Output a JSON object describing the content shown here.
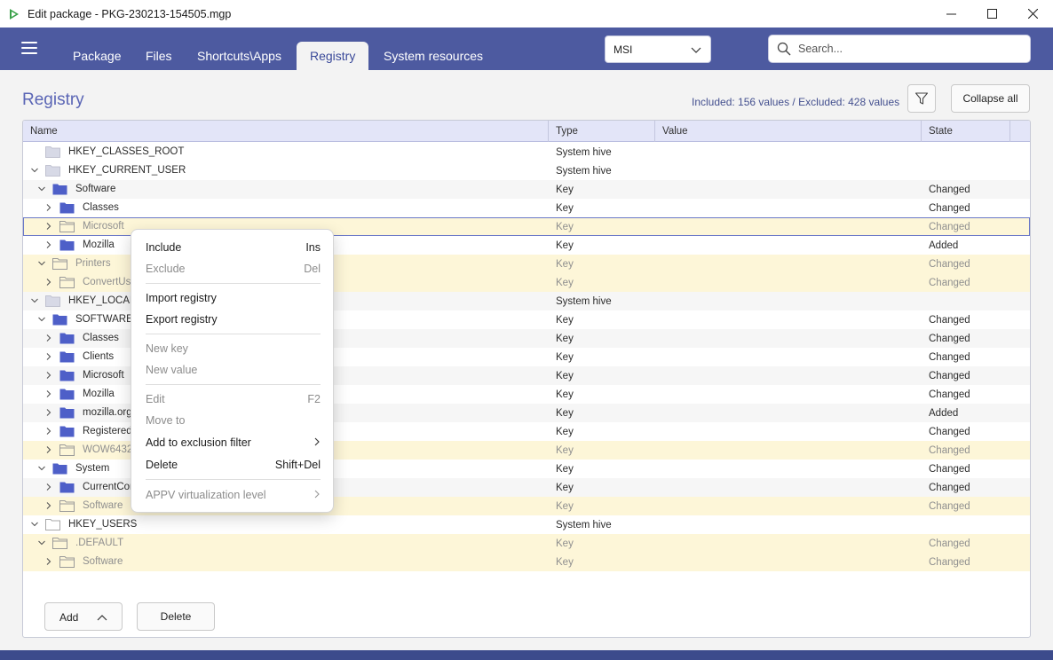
{
  "window": {
    "title": "Edit package - PKG-230213-154505.mgp"
  },
  "nav": {
    "tabs": [
      {
        "label": "Package"
      },
      {
        "label": "Files"
      },
      {
        "label": "Shortcuts\\Apps"
      },
      {
        "label": "Registry",
        "active": true
      },
      {
        "label": "System resources"
      }
    ],
    "package_type": "MSI",
    "search_placeholder": "Search..."
  },
  "page": {
    "title": "Registry",
    "summary": "Included: 156 values / Excluded: 428 values",
    "collapse_label": "Collapse all"
  },
  "table": {
    "columns": [
      "Name",
      "Type",
      "Value",
      "State"
    ],
    "rows": [
      {
        "name": "HKEY_CLASSES_ROOT",
        "type": "System hive",
        "state": ""
      },
      {
        "name": "HKEY_CURRENT_USER",
        "type": "System hive",
        "state": ""
      },
      {
        "name": "Software",
        "type": "Key",
        "state": "Changed"
      },
      {
        "name": "Classes",
        "type": "Key",
        "state": "Changed"
      },
      {
        "name": "Microsoft",
        "type": "Key",
        "state": "Changed"
      },
      {
        "name": "Mozilla",
        "type": "Key",
        "state": "Added"
      },
      {
        "name": "Printers",
        "type": "Key",
        "state": "Changed"
      },
      {
        "name": "ConvertUse",
        "type": "Key",
        "state": "Changed"
      },
      {
        "name": "HKEY_LOCAL_I",
        "type": "System hive",
        "state": ""
      },
      {
        "name": "SOFTWARE",
        "type": "Key",
        "state": "Changed"
      },
      {
        "name": "Classes",
        "type": "Key",
        "state": "Changed"
      },
      {
        "name": "Clients",
        "type": "Key",
        "state": "Changed"
      },
      {
        "name": "Microsoft",
        "type": "Key",
        "state": "Changed"
      },
      {
        "name": "Mozilla",
        "type": "Key",
        "state": "Changed"
      },
      {
        "name": "mozilla.org",
        "type": "Key",
        "state": "Added"
      },
      {
        "name": "Registered/",
        "type": "Key",
        "state": "Changed"
      },
      {
        "name": "WOW6432",
        "type": "Key",
        "state": "Changed"
      },
      {
        "name": "System",
        "type": "Key",
        "state": "Changed"
      },
      {
        "name": "CurrentCor",
        "type": "Key",
        "state": "Changed"
      },
      {
        "name": "Software",
        "type": "Key",
        "state": "Changed"
      },
      {
        "name": "HKEY_USERS",
        "type": "System hive",
        "state": ""
      },
      {
        "name": ".DEFAULT",
        "type": "Key",
        "state": "Changed"
      },
      {
        "name": "Software",
        "type": "Key",
        "state": "Changed"
      }
    ]
  },
  "buttons": {
    "add": "Add",
    "delete": "Delete"
  },
  "context_menu": {
    "items": [
      {
        "label": "Include",
        "shortcut": "Ins"
      },
      {
        "label": "Exclude",
        "shortcut": "Del"
      },
      {
        "label": "Import registry",
        "shortcut": ""
      },
      {
        "label": "Export registry",
        "shortcut": ""
      },
      {
        "label": "New key",
        "shortcut": ""
      },
      {
        "label": "New value",
        "shortcut": ""
      },
      {
        "label": "Edit",
        "shortcut": "F2"
      },
      {
        "label": "Move to",
        "shortcut": ""
      },
      {
        "label": "Add to exclusion filter",
        "shortcut": ""
      },
      {
        "label": "Delete",
        "shortcut": "Shift+Del"
      },
      {
        "label": "APPV virtualization level",
        "shortcut": ""
      }
    ]
  },
  "colors": {
    "nav_bg": "#4d5aa0",
    "accent": "#5a65b5",
    "folder_included": "#4e5fc8",
    "folder_excluded": "#a9a9a9",
    "row_excluded_bg": "#fdf6d8"
  }
}
